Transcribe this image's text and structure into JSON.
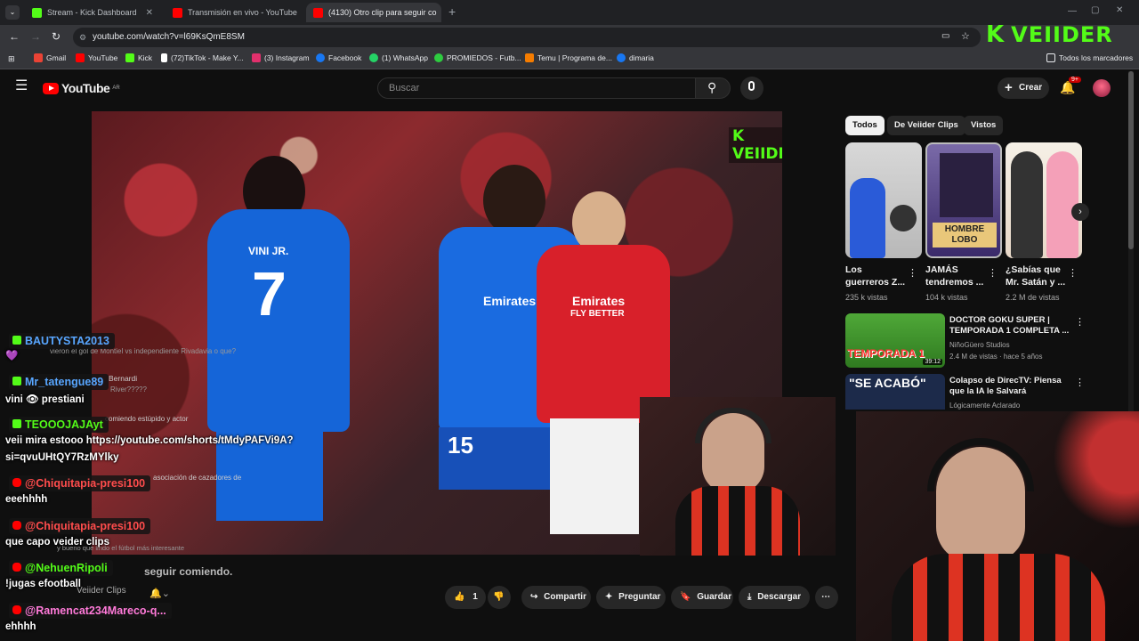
{
  "browser": {
    "tabs": [
      {
        "title": "Stream - Kick Dashboard",
        "active": false,
        "color": "#53fc18"
      },
      {
        "title": "Transmisión en vivo - YouTube",
        "active": false,
        "color": "#ff0000"
      },
      {
        "title": "(4130) Otro clip para seguir co",
        "active": true,
        "color": "#ff0000"
      }
    ],
    "url": "youtube.com/watch?v=l69KsQmE8SM",
    "bookmarks": [
      {
        "label": "Gmail",
        "color": "#ea4335"
      },
      {
        "label": "YouTube",
        "color": "#ff0000"
      },
      {
        "label": "Kick",
        "color": "#53fc18"
      },
      {
        "label": "(72)TikTok - Make Y...",
        "color": "#ffffff"
      },
      {
        "label": "(3) Instagram",
        "color": "#e1306c"
      },
      {
        "label": "Facebook",
        "color": "#1877f2"
      },
      {
        "label": "(1) WhatsApp",
        "color": "#25d366"
      },
      {
        "label": "PROMIEDOS - Futb...",
        "color": "#2ecc40"
      },
      {
        "label": "Temu | Programa de...",
        "color": "#f57c00"
      },
      {
        "label": "dimaria",
        "color": "#1877f2"
      }
    ],
    "all_bookmarks": "Todos los marcadores"
  },
  "overlay_logo": {
    "k": "K",
    "text": "VEIIDER"
  },
  "youtube": {
    "logo_text": "YouTube",
    "region": "AR",
    "search_placeholder": "Buscar",
    "create_label": "Crear",
    "notif_count": "9+",
    "watermark": "K VEIIDER",
    "channel": "Veiider Clips",
    "video_subtitle": "seguir comiendo.",
    "actions": {
      "likes": "1",
      "share": "Compartir",
      "ask": "Preguntar",
      "save": "Guardar",
      "download": "Descargar"
    },
    "chips": [
      "Todos",
      "De Veiider Clips",
      "Vistos"
    ],
    "shorts": [
      {
        "title": "Los guerreros Z...",
        "views": "235 k vistas"
      },
      {
        "title": "JAMÁS tendremos ...",
        "views": "104 k vistas",
        "thumb_text": "HOMBRE LOBO"
      },
      {
        "title": "¿Sabías que Mr. Satán y ...",
        "views": "2.2 M de vistas"
      }
    ],
    "recommended": [
      {
        "title": "DOCTOR GOKU SUPER | TEMPORADA 1 COMPLETA ...",
        "channel": "NiñoGüero Studios",
        "meta": "2.4 M de vistas · hace 5 años",
        "duration": "39:12",
        "thumb_text": "TEMPORADA 1"
      },
      {
        "title": "Colapso de DirecTV: Piensa que la IA le Salvará",
        "channel": "Lógicamente Aclarado",
        "meta": "",
        "thumb_text": "\"SE ACABÓ\""
      }
    ]
  },
  "video_jerseys": {
    "left": "VINI JR.",
    "number_left": "7",
    "center_number": "15",
    "sponsor": "Emirates",
    "sponsor2": "FLY BETTER"
  },
  "chat": [
    {
      "user": "BAUTYSTA2013",
      "message": "💜",
      "color": "#58a6ff"
    },
    {
      "user": "Mr_tatengue89",
      "message": "vini 👁 prestiani",
      "color": "#58a6ff"
    },
    {
      "user": "TEOOOJAJAyt",
      "message": "veii mira estooo https://youtube.com/shorts/tMdyPAFVi9A?",
      "message2": "si=qvuUHtQY7RzMYlky",
      "color": "#53fc18"
    },
    {
      "user": "@Chiquitapia-presi100",
      "message": "eeehhhh",
      "color": "#ff4c4c"
    },
    {
      "user": "@Chiquitapia-presi100",
      "message": "que capo veider clips",
      "color": "#ff4c4c"
    },
    {
      "user": "@NehuenRipoli",
      "message": "!jugas efootball",
      "color": "#53fc18"
    },
    {
      "user": "@Ramencat234Mareco-q...",
      "message": "ehhhh",
      "color": "#ff7ad9"
    }
  ],
  "faint_comments": [
    "vieron el gol de Montiel vs independiente Rivadavia o que?",
    "Bernardi",
    "River?????",
    "comiendo estúpido y actor",
    "asociación de cazadores de",
    "y bueno que lindo el fútbol más interesante"
  ]
}
